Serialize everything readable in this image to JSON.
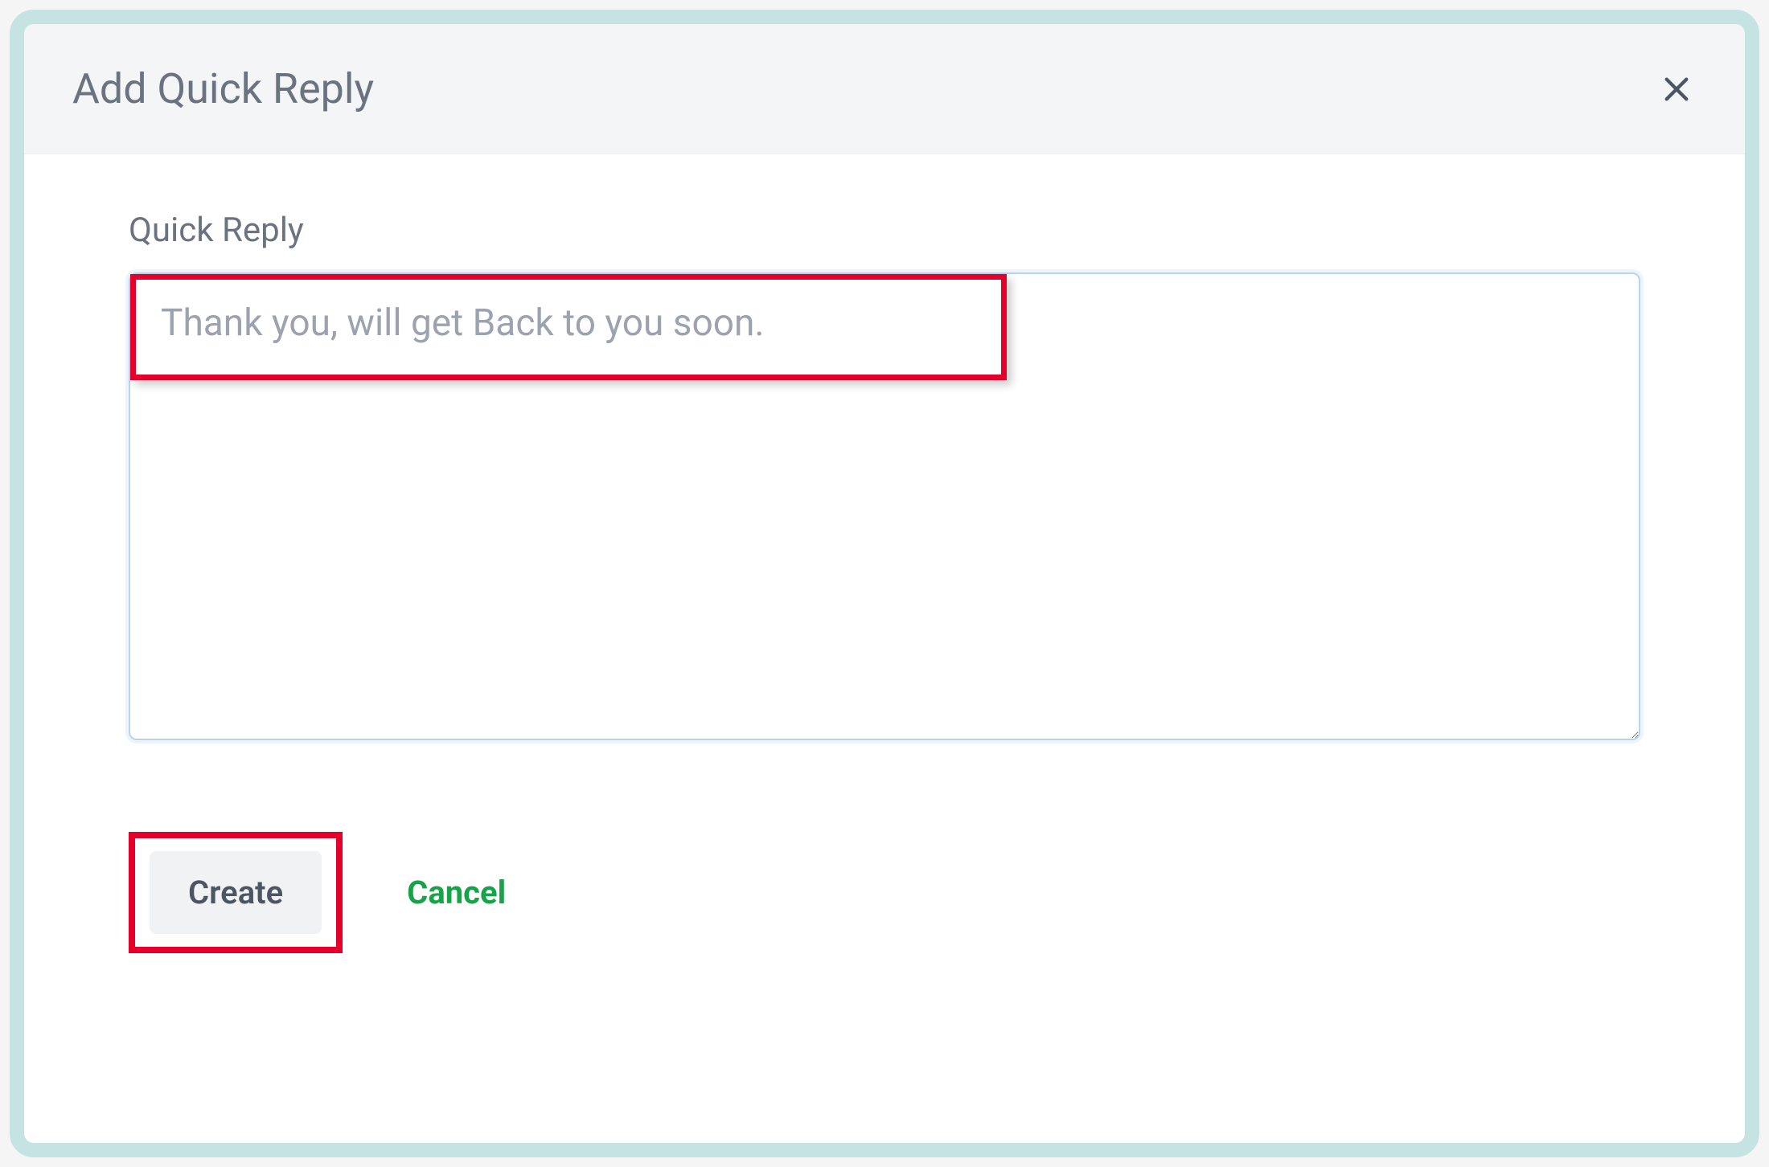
{
  "modal": {
    "title": "Add Quick Reply",
    "close_icon": "close"
  },
  "form": {
    "field_label": "Quick Reply",
    "textarea_value": "Thank you, will get Back to you soon."
  },
  "actions": {
    "create_label": "Create",
    "cancel_label": "Cancel"
  },
  "annotation": {
    "highlight_color": "#e4002b"
  }
}
